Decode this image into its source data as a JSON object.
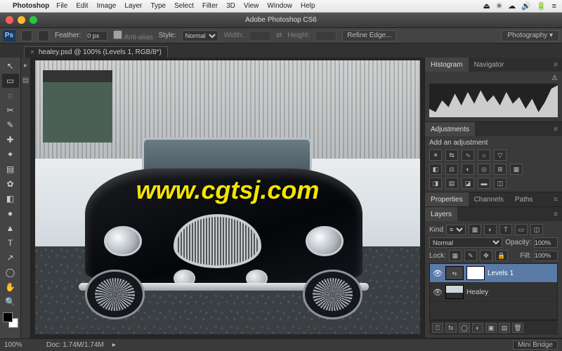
{
  "menubar": {
    "apple": "",
    "app": "Photoshop",
    "items": [
      "File",
      "Edit",
      "Image",
      "Layer",
      "Type",
      "Select",
      "Filter",
      "3D",
      "View",
      "Window",
      "Help"
    ],
    "sys": [
      "⏏",
      "✳",
      "☁",
      "🔊",
      "🔋",
      "≡"
    ]
  },
  "window": {
    "title": "Adobe Photoshop CS6"
  },
  "options": {
    "feather_label": "Feather:",
    "feather_value": "0 px",
    "antialias_label": "Anti-alias",
    "style_label": "Style:",
    "style_value": "Normal",
    "width_label": "Width:",
    "height_label": "Height:",
    "refine_label": "Refine Edge...",
    "workspace": "Photography"
  },
  "doc_tab": {
    "label": "healey.psd @ 100% (Levels 1, RGB/8*)",
    "close": "×"
  },
  "tools": [
    "↖",
    "▭",
    "◌",
    "✂",
    "✎",
    "✚",
    "✦",
    "▤",
    "✿",
    "◧",
    "●",
    "▲",
    "T",
    "↗",
    "◯",
    "✋",
    "🔍"
  ],
  "watermark": "www.cgtsj.com",
  "panels": {
    "histogram": {
      "tab1": "Histogram",
      "tab2": "Navigator"
    },
    "adjustments": {
      "tab": "Adjustments",
      "hint": "Add an adjustment"
    },
    "properties": {
      "tab1": "Properties",
      "tab2": "Channels",
      "tab3": "Paths"
    },
    "layers": {
      "tab": "Layers",
      "kind_label": "Kind",
      "blend": "Normal",
      "opacity_label": "Opacity:",
      "opacity_value": "100%",
      "lock_label": "Lock:",
      "fill_label": "Fill:",
      "fill_value": "100%",
      "items": [
        {
          "name": "Levels 1",
          "adj": true
        },
        {
          "name": "Healey",
          "adj": false
        }
      ]
    }
  },
  "status": {
    "zoom": "100%",
    "doc": "Doc: 1.74M/1.74M",
    "minibridge": "Mini Bridge"
  }
}
